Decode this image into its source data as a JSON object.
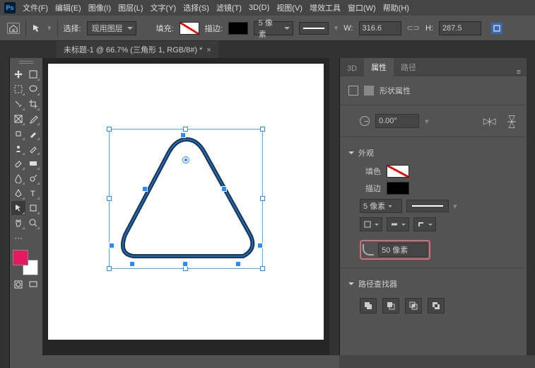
{
  "menu": {
    "file": "文件(F)",
    "edit": "编辑(E)",
    "image": "图像(I)",
    "layer": "图层(L)",
    "type": "文字(Y)",
    "select": "选择(S)",
    "filter": "滤镜(T)",
    "threed": "3D(D)",
    "view": "视图(V)",
    "plugins": "增效工具",
    "window": "窗口(W)",
    "help": "帮助(H)"
  },
  "optbar": {
    "select_lbl": "选择:",
    "select_val": "现用图层",
    "fill_lbl": "填充:",
    "stroke_lbl": "描边:",
    "stroke_w": "5 像素",
    "w_lbl": "W:",
    "w_val": "316.6",
    "h_lbl": "H:",
    "h_val": "287.5"
  },
  "tab": {
    "title": "未标题-1 @ 66.7% (三角形 1, RGB/8#) *"
  },
  "panel": {
    "tabs": {
      "threed": "3D",
      "props": "属性",
      "paths": "路径"
    },
    "shape_title": "形状属性",
    "angle": "0.00°",
    "appearance": "外观",
    "fill": "填色",
    "stroke": "描边",
    "stroke_w": "5 像素",
    "corner": "50 像素",
    "pathfinder": "路径查找器"
  }
}
